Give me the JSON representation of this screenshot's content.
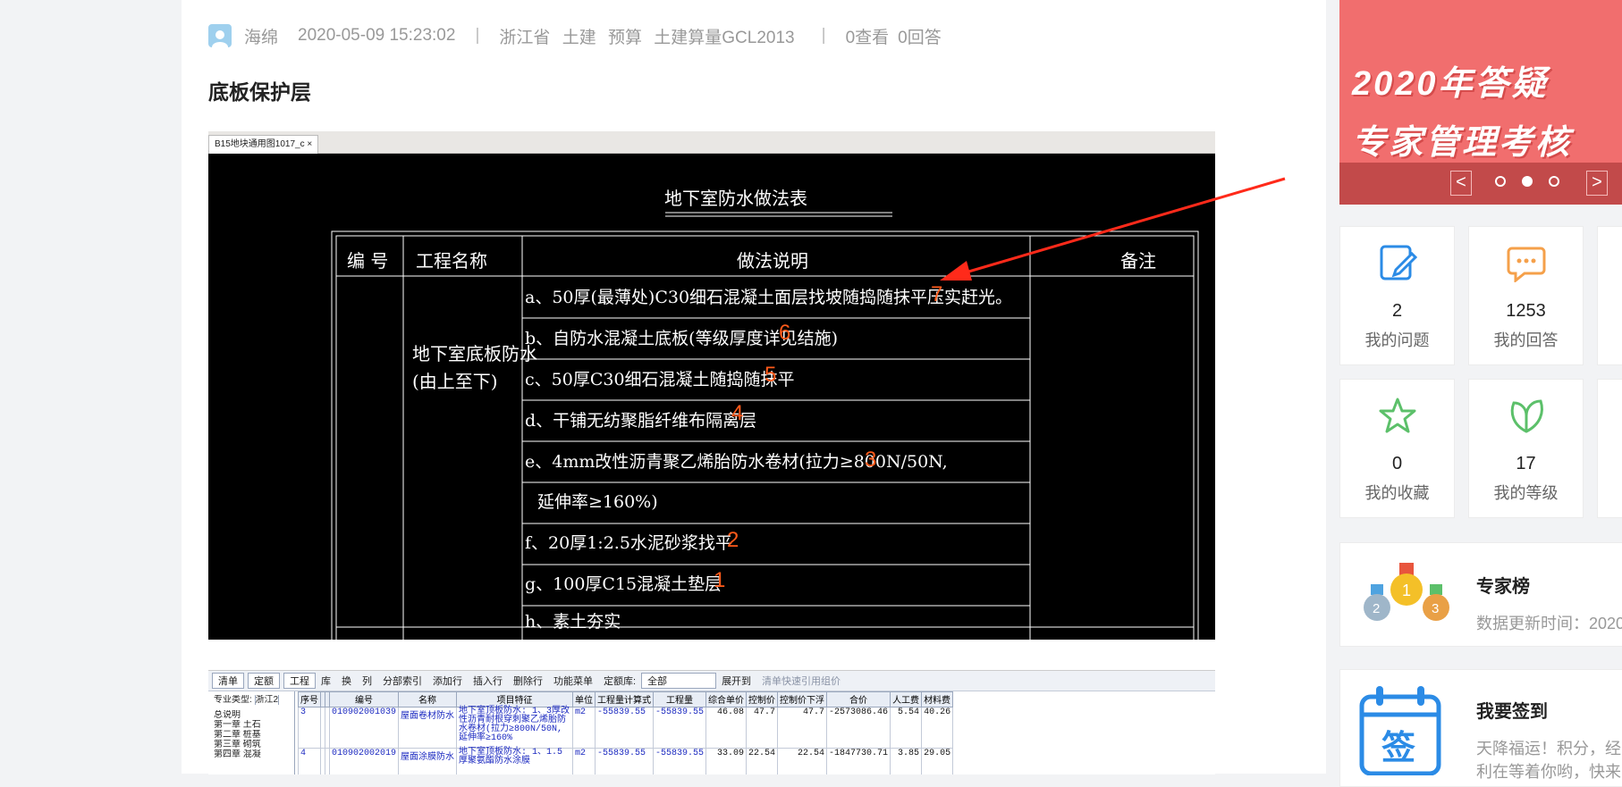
{
  "post": {
    "user": "海绵",
    "datetime": "2020-05-09 15:23:02",
    "sep": "|",
    "tags": [
      "浙江省",
      "土建",
      "预算",
      "土建算量GCL2013"
    ],
    "views": "0查看",
    "answers": "0回答",
    "title": "底板保护层"
  },
  "cad": {
    "tab": "B15地块通用图1017_c",
    "tab_close": "×",
    "table_title": "地下室防水做法表",
    "headers": [
      "编 号",
      "工程名称",
      "做法说明",
      "备注"
    ],
    "project_name_1": "地下室底板防水",
    "project_name_2": "(由上至下)",
    "rows": [
      {
        "text": "a、50厚(最薄处)C30细石混凝土面层找坡随捣随抹平压实赶光。",
        "num": "7"
      },
      {
        "text": "b、自防水混凝土底板(等级厚度详见结施)",
        "num": "6"
      },
      {
        "text": "c、50厚C30细石混凝土随捣随抹平",
        "num": "5"
      },
      {
        "text": "d、干铺无纺聚脂纤维布隔离层",
        "num": "4"
      },
      {
        "text": "e、4mm改性沥青聚乙烯胎防水卷材(拉力≥800N/50N,",
        "num": "3"
      },
      {
        "text": "延伸率≥160%)",
        "num": ""
      },
      {
        "text": "f、20厚1:2.5水泥砂浆找平",
        "num": "2"
      },
      {
        "text": "g、100厚C15混凝土垫层",
        "num": "1"
      },
      {
        "text": "h、素土夯实",
        "num": ""
      }
    ]
  },
  "software": {
    "tabs": [
      "清单",
      "定额",
      "工程"
    ],
    "toolbar": [
      "库",
      "换",
      "列",
      "分部索引",
      "添加行",
      "插入行",
      "删除行",
      "功能菜单",
      "定额库:",
      "全部",
      "展开到",
      "清单快速引用组价"
    ],
    "left_label": "专业类型:",
    "left_value": "浙江2",
    "tree": [
      "总说明",
      "第一章 土石",
      "第二章 桩基",
      "第三章 砌筑",
      "第四章 混凝"
    ],
    "headers": [
      "序号",
      "",
      "",
      "编号",
      "名称",
      "项目特征",
      "单位",
      "工程量计算式",
      "工程量",
      "综合单价",
      "控制价",
      "控制价下浮",
      "合价",
      "人工费",
      "材料费"
    ],
    "rows": [
      {
        "seq": "3",
        "code": "010902001039",
        "name": "屋面卷材防水",
        "feature": "地下室顶板防水: 1、3厚改性沥青耐根穿刺聚乙烯胎防水卷材(拉力≥800N/50N,延伸率≥160%",
        "unit": "m2",
        "formula": "-55839.55",
        "qty": "-55839.55",
        "price": "46.08",
        "ctrl": "47.7",
        "ctrl_down": "47.7",
        "total": "-2573086.46",
        "labor": "5.54",
        "material": "40.26"
      },
      {
        "seq": "4",
        "code": "010902002019",
        "name": "屋面涂膜防水",
        "feature": "地下室顶板防水: 1、1.5厚聚氨酯防水涂膜",
        "unit": "m2",
        "formula": "-55839.55",
        "qty": "-55839.55",
        "price": "33.09",
        "ctrl": "22.54",
        "ctrl_down": "22.54",
        "total": "-1847730.71",
        "labor": "3.85",
        "material": "29.05"
      }
    ]
  },
  "sidebar": {
    "banner_line1": "2020年答疑",
    "banner_line2": "专家管理考核",
    "prev": "<",
    "next": ">",
    "cards": [
      {
        "value": "2",
        "label": "我的问题",
        "icon": "edit-icon"
      },
      {
        "value": "1253",
        "label": "我的回答",
        "icon": "chat-icon"
      },
      {
        "value": "0",
        "label": "我的收藏",
        "icon": "star-icon"
      },
      {
        "value": "17",
        "label": "我的等级",
        "icon": "leaf-icon"
      }
    ],
    "experts_title": "专家榜",
    "experts_sub": "数据更新时间：2020",
    "signin_title": "我要签到",
    "signin_icon_char": "签",
    "signin_sub1": "天降福运！积分，经",
    "signin_sub2": "利在等着你哟，快来"
  },
  "colors": {
    "accent": "#f16e6e",
    "icon_blue": "#2b8be6",
    "icon_orange": "#f5a04a",
    "icon_green": "#5cc06a",
    "annot_red": "#ff2a1a"
  }
}
